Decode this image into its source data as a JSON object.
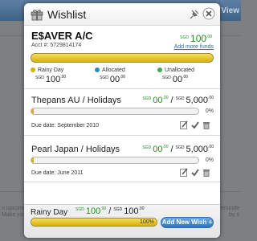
{
  "background": {
    "tab_label": "ndar View",
    "left_text_1": "n upcomin",
    "left_text_2": "Make you",
    "right_text_1": "eminde",
    "right_text_2": "by s"
  },
  "modal": {
    "title": "Wishlist",
    "icons": [
      "gift-icon",
      "pin-icon",
      "close-icon"
    ]
  },
  "account": {
    "name": "E$AVER A/C",
    "number": "Acct #: 5729814174",
    "balance_currency": "SGD",
    "balance_main": "100",
    "balance_cents": ".00",
    "add_funds_label": "Add more funds",
    "bar_fill_percent": 100
  },
  "legend": [
    {
      "label": "Rainy Day",
      "color": "#d8b011",
      "currency": "SGD",
      "main": "100",
      "cents": ".00"
    },
    {
      "label": "Allocated",
      "color": "#2a8fc0",
      "currency": "SGD",
      "main": "00",
      "cents": ".00"
    },
    {
      "label": "Unallocated",
      "color": "#3fae49",
      "currency": "SGD",
      "main": "00",
      "cents": ".00"
    }
  ],
  "wishes": [
    {
      "name": "Thepans AU / Holidays",
      "currency": "SGD",
      "saved": "00",
      "saved_cents": ".00",
      "separator": "/",
      "target_currency": "SGD",
      "target": "5,000",
      "target_cents": ".00",
      "percent": "0%",
      "progress": 0,
      "due": "Due date: September 2010"
    },
    {
      "name": "Pearl Japan / Holidays",
      "currency": "SGD",
      "saved": "00",
      "saved_cents": ".00",
      "separator": "/",
      "target_currency": "SGD",
      "target": "5,000",
      "target_cents": ".00",
      "percent": "0%",
      "progress": 0,
      "due": "Due date: June 2011"
    }
  ],
  "footer": {
    "name": "Rainy Day",
    "currency": "SGD",
    "amount": "100",
    "amount_cents": ".00",
    "separator": "/",
    "target_currency": "SGD",
    "target": "100",
    "target_cents": ".00",
    "percent": "100%",
    "progress": 100,
    "add_button_label": "Add New Wish +"
  },
  "colors": {
    "accent_green": "#1f8e1f",
    "bar_gold": "#d8b011",
    "button_blue": "#2d74bd",
    "link_blue": "#2a66b5"
  }
}
